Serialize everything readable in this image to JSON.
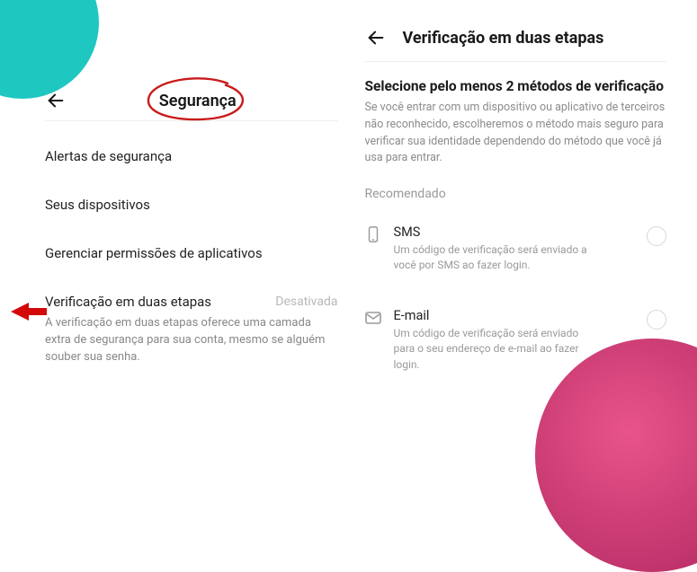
{
  "left": {
    "title": "Segurança",
    "items": [
      "Alertas de segurança",
      "Seus dispositivos",
      "Gerenciar permissões de aplicativos"
    ],
    "twoStep": {
      "label": "Verificação em duas etapas",
      "status": "Desativada",
      "description": "A verificação em duas etapas oferece uma camada extra de segurança para sua conta, mesmo se alguém souber sua senha."
    }
  },
  "right": {
    "title": "Verificação em duas etapas",
    "instructionTitle": "Selecione pelo menos 2 métodos de verificação",
    "instructionBody": "Se você entrar com um dispositivo ou aplicativo de terceiros não reconhecido, escolheremos o método mais seguro para verificar sua identidade dependendo do método que você já usa para entrar.",
    "sectionLabel": "Recomendado",
    "methods": [
      {
        "title": "SMS",
        "description": "Um código de verificação será enviado a você por SMS ao fazer login."
      },
      {
        "title": "E-mail",
        "description": "Um código de verificação será enviado para o seu endereço de e-mail ao fazer login."
      }
    ]
  }
}
